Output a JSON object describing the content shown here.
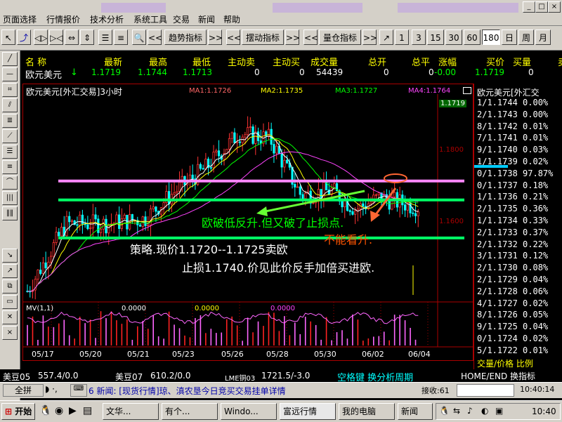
{
  "menu": {
    "items": [
      "页面选择",
      "行情报价",
      "技术分析",
      "系统工具",
      "交易",
      "新闻",
      "帮助"
    ]
  },
  "window_controls": [
    "_",
    "□",
    "×"
  ],
  "toolbar": {
    "trend_indicator": "趋势指标",
    "swing_indicator": "摆动指标",
    "volume_indicator": "量仓指标",
    "more": ">>",
    "periods": [
      "1",
      "3",
      "15",
      "30",
      "60",
      "180",
      "日",
      "周",
      "月"
    ],
    "selected_period": "180"
  },
  "quote_header": {
    "columns": [
      "名  称",
      "最新",
      "最高",
      "最低",
      "主动卖",
      "主动买",
      "成交量",
      "总开",
      "总平",
      "涨幅",
      "买价",
      "买量",
      "卖"
    ],
    "name": "欧元美元",
    "latest": "1.1719",
    "high": "1.1744",
    "low": "1.1713",
    "active_sell": "0",
    "active_buy": "0",
    "volume": "54439",
    "total_open": "0",
    "total_close": "0",
    "change": "-0.00",
    "bid": "1.1719",
    "bid_vol": "0"
  },
  "chart": {
    "title": "欧元美元[外汇交易]3小时",
    "ma1": "MA1:1.1726",
    "ma2": "MA2:1.1735",
    "ma3": "MA3:1.1727",
    "ma4": "MA4:1.1764",
    "price_tag": "1.1719",
    "y_tick_1": "1.1800",
    "y_tick_2": "1.1600",
    "annotation_1": "欧破低反升.但又破了止损点.",
    "annotation_2": "不能看升.",
    "strategy_line_1": "策略.现价1.1720--1.1725卖欧",
    "strategy_line_2": "止损1.1740.价见此价反手加倍买进欧.",
    "mv_label": "MV(1,1)",
    "mv_values": [
      "0.0000",
      "0.0000",
      "0.0000"
    ],
    "x_labels": [
      "05/17",
      "05/20",
      "05/21",
      "05/23",
      "05/26",
      "05/28",
      "05/30",
      "06/02",
      "06/04"
    ]
  },
  "chart_data": {
    "type": "candlestick",
    "title": "欧元美元[外汇交易]3小时",
    "moving_averages": [
      {
        "name": "MA1",
        "value": 1.1726,
        "color": "#ffffff"
      },
      {
        "name": "MA2",
        "value": 1.1735,
        "color": "#ffff00"
      },
      {
        "name": "MA3",
        "value": 1.1727,
        "color": "#00ff00"
      },
      {
        "name": "MA4",
        "value": 1.1764,
        "color": "#ff44ff"
      }
    ],
    "ylim": [
      1.154,
      1.196
    ],
    "x": [
      "05/17",
      "05/20",
      "05/21",
      "05/23",
      "05/26",
      "05/28",
      "05/30",
      "06/02",
      "06/04"
    ],
    "horizontal_lines": [
      {
        "value": 1.178,
        "color": "#ff88ff"
      },
      {
        "value": 1.174,
        "color": "#00ff66"
      },
      {
        "value": 1.166,
        "color": "#00ff66"
      }
    ]
  },
  "side_panel": {
    "title": "欧元美元[外汇交",
    "rows": [
      "1/1.1744 0.00%",
      "2/1.1743 0.00%",
      "8/1.1742 0.01%",
      "7/1.1741 0.01%",
      "9/1.1740 0.03%",
      "1/1.1739 0.02%",
      "0/1.1738 97.87%",
      "0/1.1737 0.18%",
      "1/1.1736 0.21%",
      "2/1.1735 0.36%",
      "1/1.1734 0.33%",
      "2/1.1733 0.37%",
      "2/1.1732 0.22%",
      "3/1.1731 0.12%",
      "2/1.1730 0.08%",
      "2/1.1729 0.04%",
      "2/1.1728 0.06%",
      "4/1.1727 0.02%",
      "8/1.1726 0.05%",
      "9/1.1725 0.04%",
      "0/1.1724 0.02%",
      "5/1.1722 0.01%"
    ],
    "footer": "交量/价格 比例"
  },
  "infobar": {
    "item1": "美豆05",
    "item1_val": "557.4/0.0",
    "item2": "美豆07",
    "item2_val": "610.2/0.0",
    "item3": "LME铜03",
    "item3_val": "1721.5/-3.0",
    "hint1": "空格键 换分析周期",
    "hint2": "HOME/END 换指标"
  },
  "newsbar": {
    "fullscreen": "全拼",
    "news": "6 新闻: [现货行情]琼、滇农垦今日竞买交易挂单详情",
    "recv": "接收:61",
    "time": "10:40:14"
  },
  "taskbar": {
    "start": "开始",
    "tasks": [
      "文华...",
      "有个...",
      "Windo...",
      "富远行情",
      "我的电脑",
      "新闻"
    ],
    "clock": "10:40"
  }
}
